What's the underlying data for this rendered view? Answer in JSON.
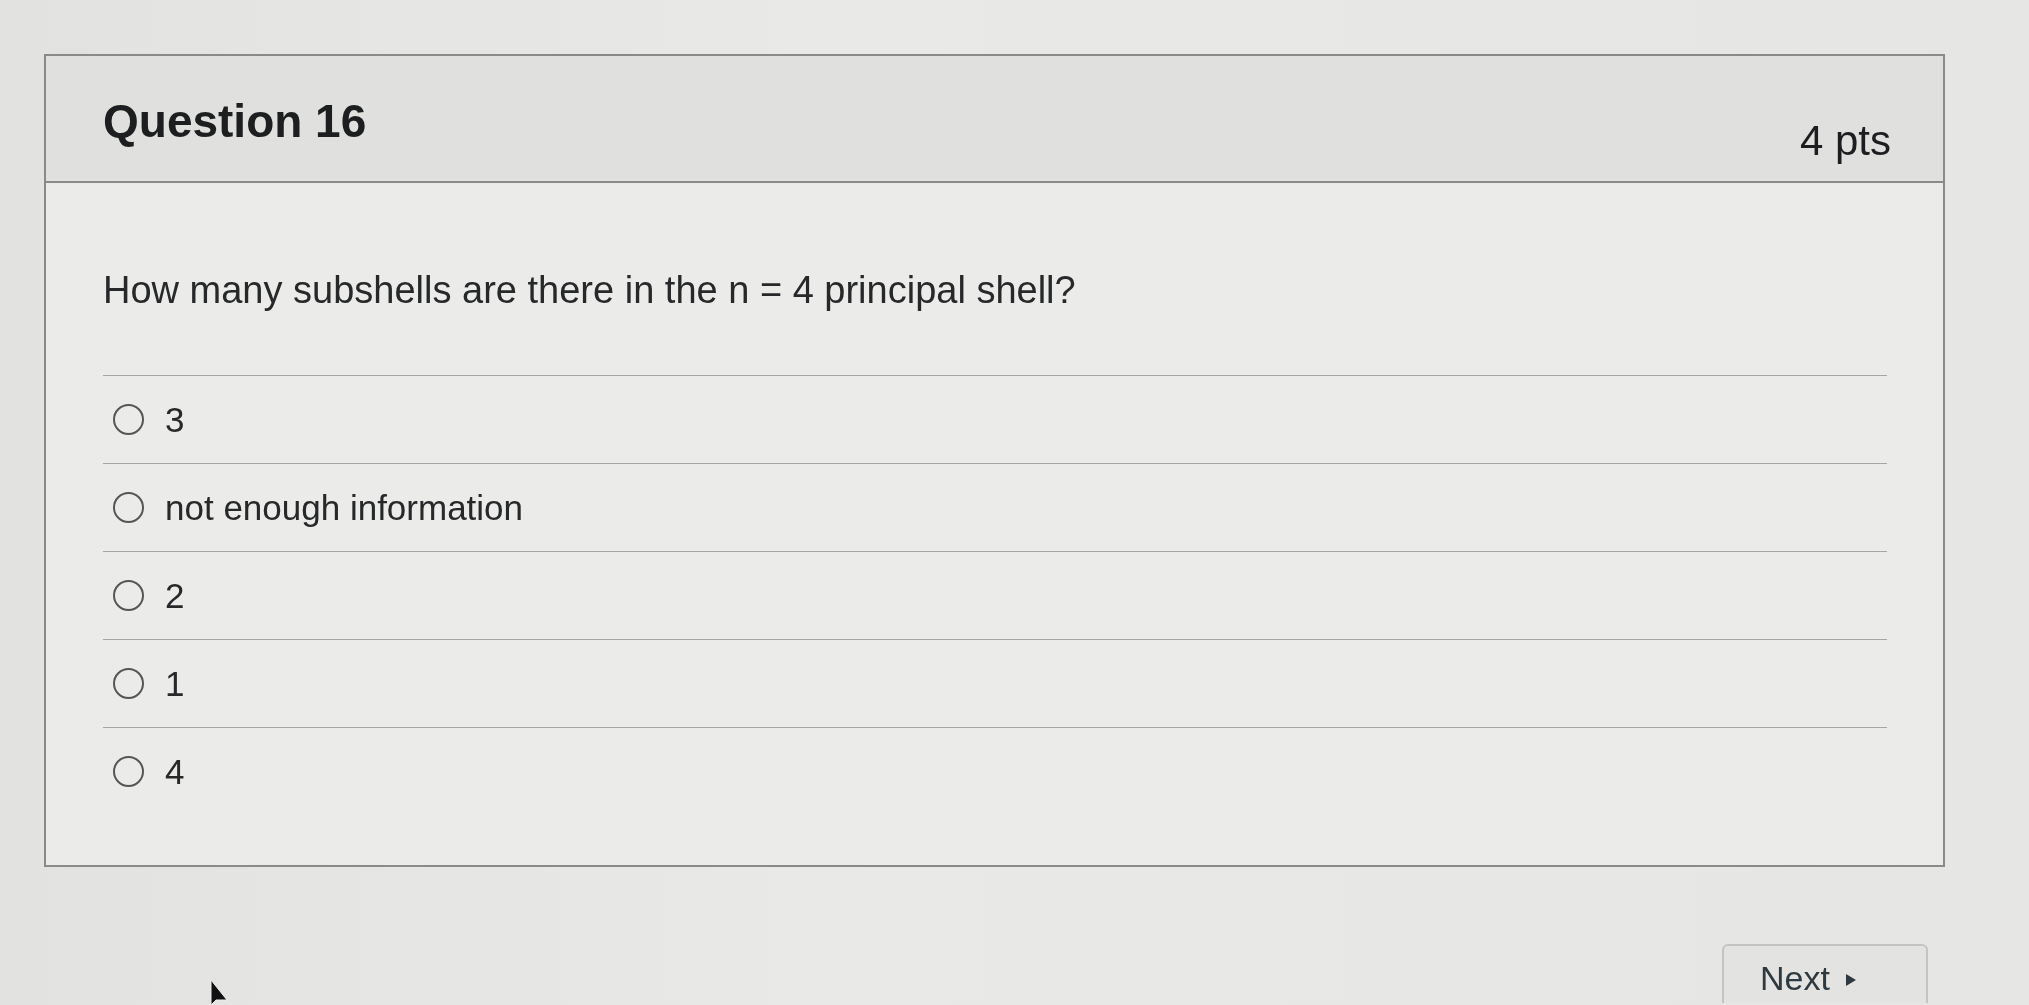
{
  "quiz_question": {
    "title": "Question 16",
    "points": "4 pts",
    "prompt": "How many subshells are there in the n = 4 principal shell?",
    "options": [
      {
        "label": "3",
        "selected": false
      },
      {
        "label": "not enough information",
        "selected": false
      },
      {
        "label": "2",
        "selected": false
      },
      {
        "label": "1",
        "selected": false
      },
      {
        "label": "4",
        "selected": false
      }
    ]
  },
  "navigation": {
    "next_button": {
      "label": "Next"
    }
  }
}
